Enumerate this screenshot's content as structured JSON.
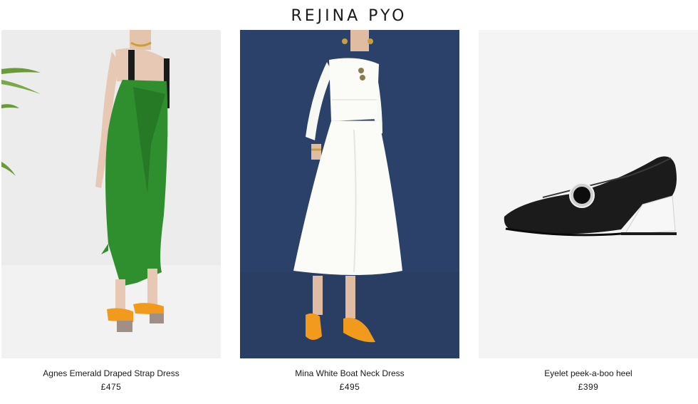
{
  "brand": {
    "name": "REJINA PYO"
  },
  "products": [
    {
      "name": "Agnes Emerald Draped Strap Dress",
      "price": "£475",
      "image": "model-green-dress-back"
    },
    {
      "name": "Mina White Boat Neck Dress",
      "price": "£495",
      "image": "model-white-dress-front"
    },
    {
      "name": "Eyelet peek-a-boo heel",
      "price": "£399",
      "image": "black-leather-shoe"
    }
  ],
  "colors": {
    "background": "#ffffff",
    "text": "#1a1a1a",
    "navy_backdrop": "#2b4068",
    "emerald": "#2f8f2f",
    "orange_shoe": "#f29a1c"
  }
}
